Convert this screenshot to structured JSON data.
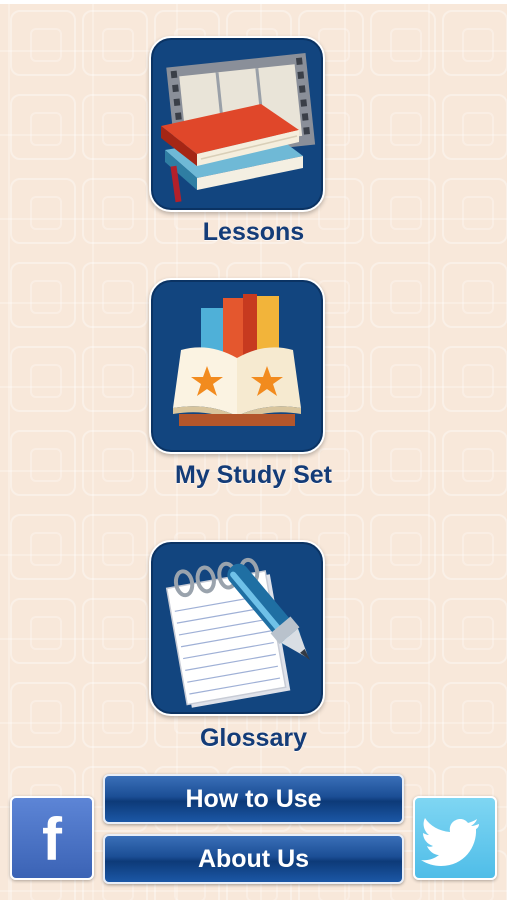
{
  "menu": {
    "lessons_label": "Lessons",
    "study_set_label": "My Study Set",
    "glossary_label": "Glossary"
  },
  "footer": {
    "how_to_use_label": "How to Use",
    "about_us_label": "About Us",
    "facebook_glyph": "f"
  },
  "icons": {
    "lessons": "books-and-film-icon",
    "study_set": "open-book-stars-icon",
    "glossary": "notepad-pen-icon",
    "facebook": "facebook-icon",
    "twitter": "twitter-bird-icon"
  },
  "colors": {
    "background": "#f5dcc6",
    "tile_blue": "#12457f",
    "label_blue": "#143c78",
    "button_blue": "#1b4e95",
    "facebook_blue": "#4a72c4",
    "twitter_blue": "#5fc8ee"
  }
}
